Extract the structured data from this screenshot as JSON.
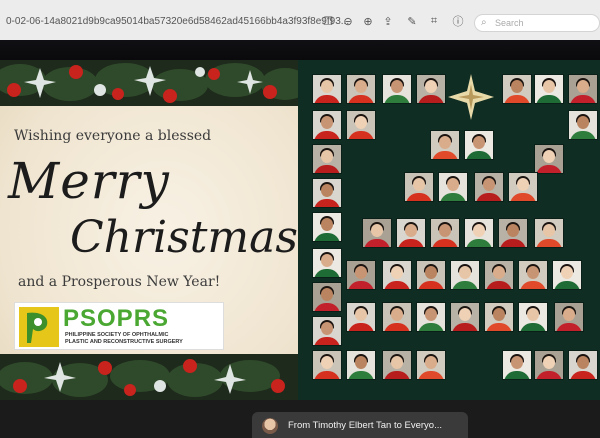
{
  "browser": {
    "url": "0-02-06-14a8021d9b9ca95014ba57320e6d58462ad45166bb4a3f93f8e9f93...",
    "search_placeholder": "Search",
    "toolbar_icons": [
      "copy-icon",
      "zoom-out-icon",
      "zoom-in-icon",
      "share-icon",
      "annotate-icon",
      "crop-icon",
      "info-icon"
    ]
  },
  "card": {
    "wish_line": "Wishing everyone a blessed",
    "merry": "Merry",
    "christmas": "Christmas",
    "prosper_line": "and a Prosperous New Year!",
    "logo_name": "PSOPRS",
    "logo_subtitle": "PHILIPPINE SOCIETY OF OPHTHALMIC PLASTIC AND RECONSTRUCTIVE SURGERY",
    "colors": {
      "logo_green": "#4aa832",
      "logo_yellow": "#e6c619",
      "ornament_red": "#c8231d"
    }
  },
  "tree": {
    "background": "#0f2d22",
    "star_color": "#e8d9a8",
    "participant_count": 58
  },
  "chat_toast": {
    "text": "From Timothy Elbert Tan to Everyo..."
  }
}
